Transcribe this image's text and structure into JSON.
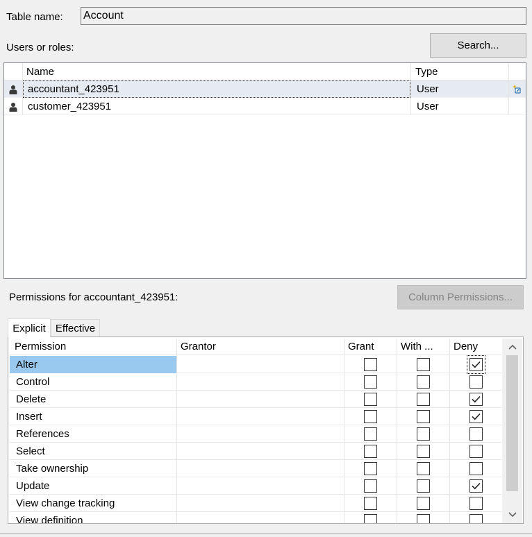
{
  "table_name": {
    "label": "Table name:",
    "value": "Account"
  },
  "users": {
    "label": "Users or roles:",
    "search_button": "Search...",
    "columns": {
      "name": "Name",
      "type": "Type"
    },
    "rows": [
      {
        "name": "accountant_423951",
        "type": "User",
        "selected": true
      },
      {
        "name": "customer_423951",
        "type": "User",
        "selected": false
      }
    ],
    "new_item_icon": "sparkle-edit-icon"
  },
  "permissions": {
    "label": "Permissions for accountant_423951:",
    "column_permissions_button": "Column Permissions...",
    "tabs": [
      {
        "label": "Explicit",
        "active": true
      },
      {
        "label": "Effective",
        "active": false
      }
    ],
    "columns": {
      "permission": "Permission",
      "grantor": "Grantor",
      "grant": "Grant",
      "with_grant": "With ...",
      "deny": "Deny"
    },
    "rows": [
      {
        "permission": "Alter",
        "grantor": "",
        "grant": false,
        "with_grant": false,
        "deny": true,
        "selected": true
      },
      {
        "permission": "Control",
        "grantor": "",
        "grant": false,
        "with_grant": false,
        "deny": false
      },
      {
        "permission": "Delete",
        "grantor": "",
        "grant": false,
        "with_grant": false,
        "deny": true
      },
      {
        "permission": "Insert",
        "grantor": "",
        "grant": false,
        "with_grant": false,
        "deny": true
      },
      {
        "permission": "References",
        "grantor": "",
        "grant": false,
        "with_grant": false,
        "deny": false
      },
      {
        "permission": "Select",
        "grantor": "",
        "grant": false,
        "with_grant": false,
        "deny": false
      },
      {
        "permission": "Take ownership",
        "grantor": "",
        "grant": false,
        "with_grant": false,
        "deny": false
      },
      {
        "permission": "Update",
        "grantor": "",
        "grant": false,
        "with_grant": false,
        "deny": true
      },
      {
        "permission": "View change tracking",
        "grantor": "",
        "grant": false,
        "with_grant": false,
        "deny": false
      },
      {
        "permission": "View definition",
        "grantor": "",
        "grant": false,
        "with_grant": false,
        "deny": false
      }
    ]
  },
  "colors": {
    "selected_row": "#99c9ef",
    "selected_user": "#e5ebf1",
    "window_bg": "#f0f0f0"
  }
}
